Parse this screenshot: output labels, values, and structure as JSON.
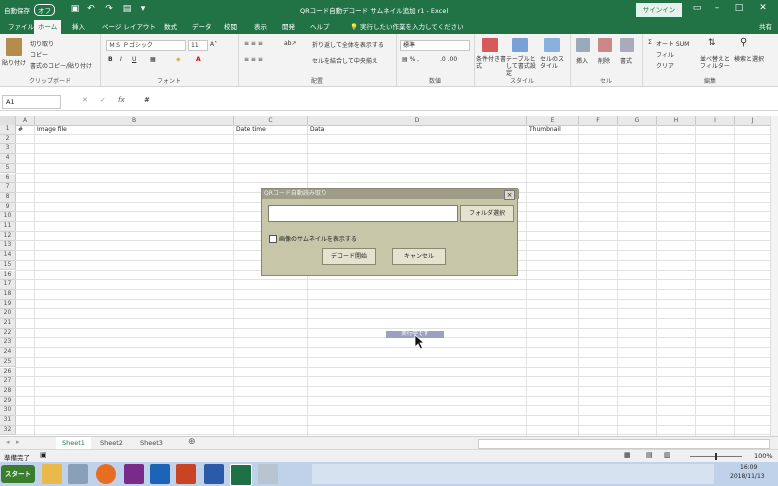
{
  "titlebar": {
    "autosave": "自動保存",
    "autosave_state": "オフ",
    "title": "QRコード自動デコード サムネイル追加 r1  -  Excel",
    "signin": "サインイン"
  },
  "tabs": [
    "ファイル",
    "ホーム",
    "挿入",
    "ページ レイアウト",
    "数式",
    "データ",
    "校閲",
    "表示",
    "開発",
    "ヘルプ"
  ],
  "tellme": "実行したい作業を入力してください",
  "share": "共有",
  "ribbon": {
    "clipboard": {
      "paste": "貼り付け",
      "cut": "切り取り",
      "copy": "コピー",
      "format_painter": "書式のコピー/貼り付け",
      "label": "クリップボード"
    },
    "font": {
      "name": "ＭＳ Ｐゴシック",
      "size": "11",
      "bold": "B",
      "italic": "I",
      "underline": "U",
      "label": "フォント"
    },
    "alignment": {
      "wrap": "折り返して全体を表示する",
      "merge": "セルを結合して中央揃え",
      "label": "配置"
    },
    "number": {
      "format": "標準",
      "label": "数値"
    },
    "styles": {
      "conditional": "条件付き書式",
      "table": "テーブルとして書式設定",
      "cell": "セルのスタイル",
      "label": "スタイル"
    },
    "cells": {
      "insert": "挿入",
      "delete": "削除",
      "format": "書式",
      "label": "セル"
    },
    "editing": {
      "autosum": "オート SUM",
      "fill": "フィル",
      "clear": "クリア",
      "sort": "並べ替えとフィルター",
      "find": "検索と選択",
      "label": "編集"
    }
  },
  "formula_bar": {
    "namebox": "A1",
    "fx": "fx",
    "value": "#"
  },
  "columns": [
    "A",
    "B",
    "C",
    "D",
    "E",
    "F",
    "G",
    "H",
    "I",
    "J"
  ],
  "rows": [
    "1",
    "2",
    "3",
    "4",
    "5",
    "6",
    "7",
    "8",
    "9",
    "10",
    "11",
    "12",
    "13",
    "14",
    "15",
    "16",
    "17",
    "18",
    "19",
    "20",
    "21",
    "22",
    "23",
    "24",
    "25",
    "26",
    "27",
    "28",
    "29",
    "30",
    "31",
    "32"
  ],
  "header_row": {
    "a": "#",
    "b": "Image file",
    "c": "Date time",
    "d": "Data",
    "e": "Thumbnail"
  },
  "dialog": {
    "title": "QRコード自動読み取り",
    "folder_button": "フォルダ選択",
    "folder_path": "",
    "checkbox_label": "画像のサムネイルを表示する",
    "decode_button": "デコード開始",
    "cancel_button": "キャンセル"
  },
  "tooltip": "実行中です",
  "sheets": [
    "Sheet1",
    "Sheet2",
    "Sheet3"
  ],
  "status": {
    "ready": "準備完了",
    "zoom": "100%"
  },
  "taskbar": {
    "start": "スタート",
    "time": "16:09",
    "date": "2018/11/13"
  }
}
